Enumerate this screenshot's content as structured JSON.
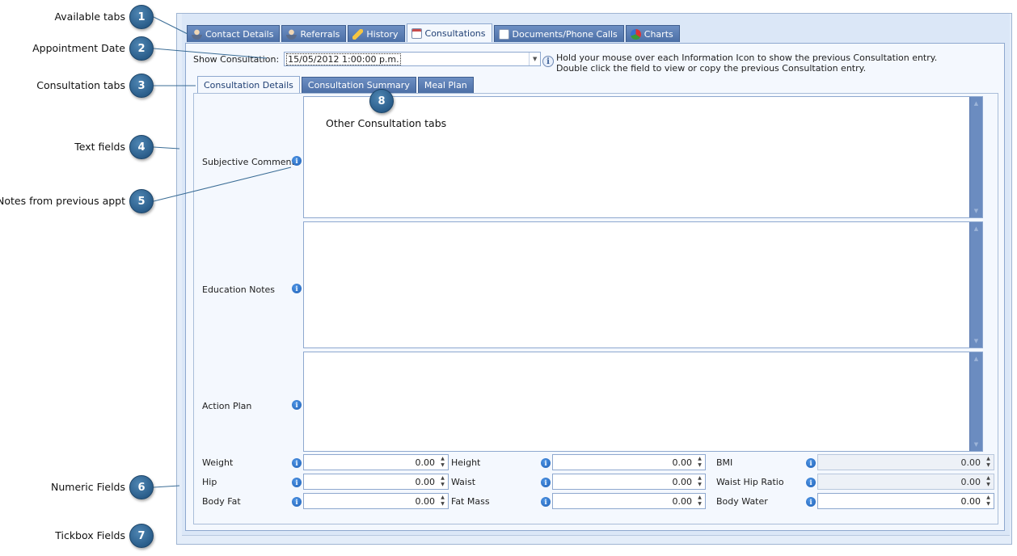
{
  "callouts": [
    {
      "n": "1",
      "label": "Available tabs"
    },
    {
      "n": "2",
      "label": "Appointment Date"
    },
    {
      "n": "3",
      "label": "Consultation tabs"
    },
    {
      "n": "4",
      "label": "Text fields"
    },
    {
      "n": "5",
      "label": "Notes from previous appt"
    },
    {
      "n": "6",
      "label": "Numeric Fields"
    },
    {
      "n": "7",
      "label": "Tickbox Fields"
    },
    {
      "n": "8",
      "label": ""
    }
  ],
  "overlay_note": "Other Consultation tabs",
  "main_tabs": [
    {
      "label": "Contact Details",
      "icon": "person-icon"
    },
    {
      "label": "Referrals",
      "icon": "person-icon"
    },
    {
      "label": "History",
      "icon": "pencil-icon"
    },
    {
      "label": "Consultations",
      "icon": "calendar-icon",
      "active": true
    },
    {
      "label": "Documents/Phone Calls",
      "icon": "document-icon"
    },
    {
      "label": "Charts",
      "icon": "chart-icon"
    }
  ],
  "consultation": {
    "label": "Show Consultation:",
    "value": "15/05/2012 1:00:00 p.m.",
    "hint_line1": "Hold your mouse over each Information Icon to show the previous Consultation entry.",
    "hint_line2": "Double click the field to view or copy the previous Consultation entry."
  },
  "sub_tabs": [
    {
      "label": "Consultation Details",
      "active": true
    },
    {
      "label": "Consultation Summary"
    },
    {
      "label": "Meal Plan"
    }
  ],
  "text_fields": [
    {
      "label": "Subjective Comments"
    },
    {
      "label": "Education Notes"
    },
    {
      "label": "Action Plan"
    }
  ],
  "numeric_fields": [
    [
      {
        "label": "Weight",
        "value": "0.00"
      },
      {
        "label": "Height",
        "value": "0.00"
      },
      {
        "label": "BMI",
        "value": "0.00",
        "disabled": true
      }
    ],
    [
      {
        "label": "Hip",
        "value": "0.00"
      },
      {
        "label": "Waist",
        "value": "0.00"
      },
      {
        "label": "Waist Hip Ratio",
        "value": "0.00",
        "disabled": true
      }
    ],
    [
      {
        "label": "Body Fat",
        "value": "0.00"
      },
      {
        "label": "Fat Mass",
        "value": "0.00"
      },
      {
        "label": "Body Water",
        "value": "0.00"
      }
    ]
  ],
  "colors": {
    "badge": "#2a5d8a",
    "tab_inactive": "#5a7db3",
    "tab_page": "#f4f8fe",
    "info_icon": "#1e5fb5"
  }
}
